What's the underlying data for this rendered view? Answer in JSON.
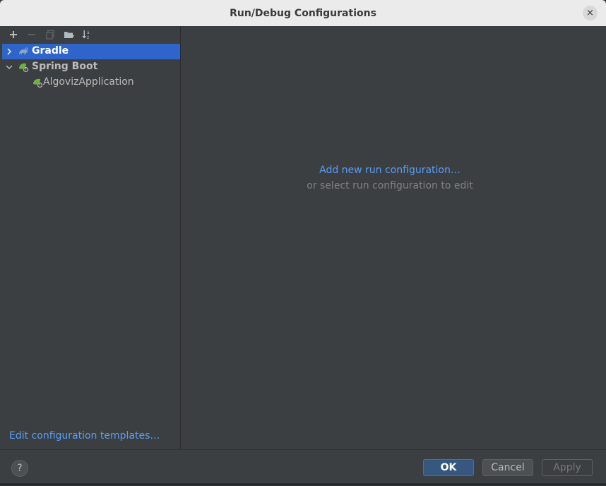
{
  "dialog": {
    "title": "Run/Debug Configurations",
    "close_glyph": "×"
  },
  "toolbar": {
    "items": [
      {
        "name": "add-icon"
      },
      {
        "name": "remove-icon"
      },
      {
        "name": "copy-icon"
      },
      {
        "name": "folder-add-icon"
      },
      {
        "name": "sort-az-icon"
      }
    ]
  },
  "tree": {
    "items": [
      {
        "label": "Gradle",
        "icon": "gradle-icon",
        "expanded": false,
        "selected": true,
        "level": 0
      },
      {
        "label": "Spring Boot",
        "icon": "spring-boot-icon",
        "expanded": true,
        "selected": false,
        "level": 0
      },
      {
        "label": "AlgovizApplication",
        "icon": "spring-boot-icon",
        "selected": false,
        "level": 1
      }
    ]
  },
  "left_panel": {
    "edit_templates_link": "Edit configuration templates…"
  },
  "right_panel": {
    "add_link": "Add new run configuration…",
    "hint": "or select run configuration to edit"
  },
  "footer": {
    "help_glyph": "?",
    "ok_label": "OK",
    "cancel_label": "Cancel",
    "apply_label": "Apply"
  },
  "colors": {
    "selection": "#2f65ca",
    "link": "#589df6",
    "spring_green": "#6db33f",
    "primary_button": "#365880"
  }
}
